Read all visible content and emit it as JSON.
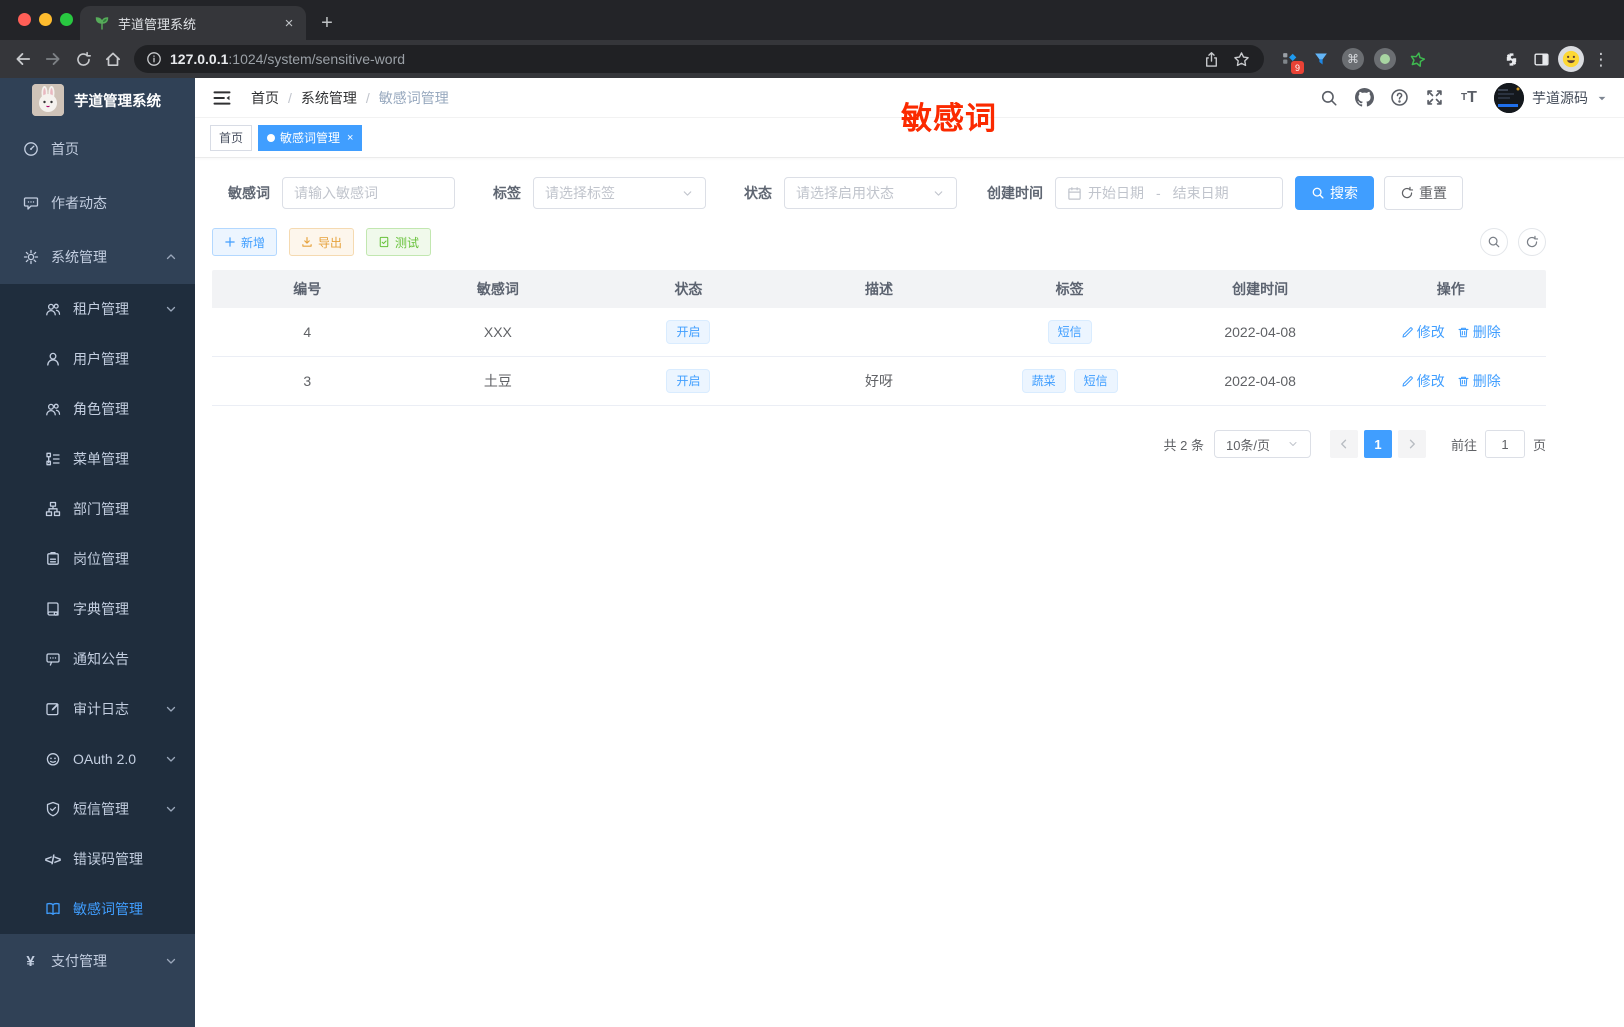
{
  "colors": {
    "accent": "#409eff",
    "annotation": "#fb2a00",
    "warning": "#e6a23c",
    "success": "#67c23a",
    "sidebar_bg": "#304156",
    "submenu_bg": "#1f2d3d"
  },
  "browser": {
    "tab_title": "芋道管理系统",
    "close_glyph": "×",
    "new_tab_glyph": "+",
    "url_host": "127.0.0.1",
    "url_path": ":1024/system/sensitive-word",
    "extension_badge": "9",
    "extensions": [
      "pin-grid",
      "funnel",
      "command",
      "record",
      "green-star",
      "puzzle",
      "split-view"
    ]
  },
  "sidebar": {
    "app_title": "芋道管理系统",
    "menu": [
      {
        "label": "首页",
        "icon": "dashboard",
        "level": 1
      },
      {
        "label": "作者动态",
        "icon": "chat",
        "level": 1
      },
      {
        "label": "系统管理",
        "icon": "gear",
        "level": 1,
        "chevron": "up"
      },
      {
        "label": "租户管理",
        "icon": "users",
        "level": 2,
        "chevron": "down"
      },
      {
        "label": "用户管理",
        "icon": "user",
        "level": 2
      },
      {
        "label": "角色管理",
        "icon": "users",
        "level": 2
      },
      {
        "label": "菜单管理",
        "icon": "menu-tree",
        "level": 2
      },
      {
        "label": "部门管理",
        "icon": "org",
        "level": 2
      },
      {
        "label": "岗位管理",
        "icon": "badge",
        "level": 2
      },
      {
        "label": "字典管理",
        "icon": "dict",
        "level": 2
      },
      {
        "label": "通知公告",
        "icon": "notice",
        "level": 2
      },
      {
        "label": "审计日志",
        "icon": "log",
        "level": 2,
        "chevron": "down"
      },
      {
        "label": "OAuth 2.0",
        "icon": "robot",
        "level": 2,
        "chevron": "down"
      },
      {
        "label": "短信管理",
        "icon": "shield",
        "level": 2,
        "chevron": "down"
      },
      {
        "label": "错误码管理",
        "icon": "code",
        "level": 2
      },
      {
        "label": "敏感词管理",
        "icon": "open-book",
        "level": 2,
        "active": true
      },
      {
        "label": "支付管理",
        "icon": "yen",
        "level": 1,
        "chevron": "down"
      }
    ]
  },
  "navbar": {
    "breadcrumb": [
      "首页",
      "系统管理",
      "敏感词管理"
    ],
    "username": "芋道源码"
  },
  "annotation": {
    "text": "敏感词"
  },
  "tags_view": [
    {
      "label": "首页"
    },
    {
      "label": "敏感词管理",
      "active": true,
      "closable": true
    }
  ],
  "filter": {
    "keyword_label": "敏感词",
    "keyword_placeholder": "请输入敏感词",
    "tag_label": "标签",
    "tag_placeholder": "请选择标签",
    "status_label": "状态",
    "status_placeholder": "请选择启用状态",
    "date_label": "创建时间",
    "date_start_placeholder": "开始日期",
    "date_separator": "-",
    "date_end_placeholder": "结束日期",
    "search_label": "搜索",
    "reset_label": "重置"
  },
  "actions": {
    "add": "新增",
    "export": "导出",
    "test": "测试"
  },
  "table": {
    "columns": [
      "编号",
      "敏感词",
      "状态",
      "描述",
      "标签",
      "创建时间",
      "操作"
    ],
    "rows": [
      {
        "id": "4",
        "word": "XXX",
        "status": "开启",
        "description": "",
        "tags": [
          "短信"
        ],
        "created_at": "2022-04-08"
      },
      {
        "id": "3",
        "word": "土豆",
        "status": "开启",
        "description": "好呀",
        "tags": [
          "蔬菜",
          "短信"
        ],
        "created_at": "2022-04-08"
      }
    ],
    "edit_label": "修改",
    "delete_label": "删除"
  },
  "pagination": {
    "total": "共 2 条",
    "page_size": "10条/页",
    "current_page": "1",
    "goto_label": "前往",
    "goto_value": "1",
    "page_unit": "页"
  }
}
